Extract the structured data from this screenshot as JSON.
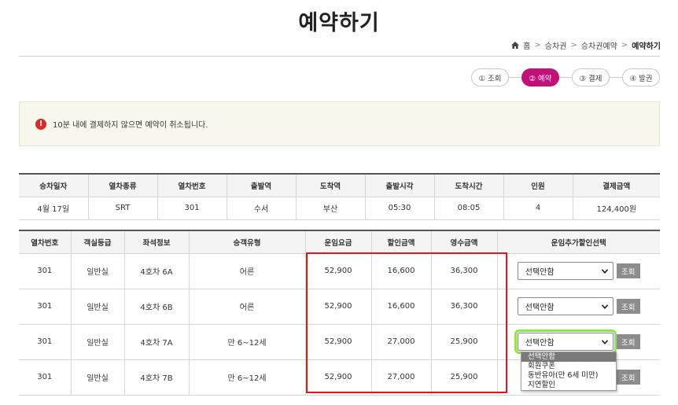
{
  "page": {
    "title": "예약하기"
  },
  "breadcrumb": {
    "home": "홈",
    "items": [
      "승차권",
      "승차권예약"
    ],
    "current": "예약하기"
  },
  "steps": [
    {
      "label": "① 조회",
      "active": false
    },
    {
      "label": "② 예약",
      "active": true
    },
    {
      "label": "③ 결제",
      "active": false
    },
    {
      "label": "④ 발권",
      "active": false
    }
  ],
  "notice": {
    "text": "10분 내에 결제하지 않으면 예약이 취소됩니다."
  },
  "summary": {
    "headers": [
      "승차일자",
      "열차종류",
      "열차번호",
      "출발역",
      "도착역",
      "출발시각",
      "도착시간",
      "인원",
      "결제금액"
    ],
    "row": [
      "4월 17일",
      "SRT",
      "301",
      "수서",
      "부산",
      "05:30",
      "08:05",
      "4",
      "124,400원"
    ]
  },
  "passengers": {
    "headers": [
      "열차번호",
      "객실등급",
      "좌석정보",
      "승객유형",
      "운임요금",
      "할인금액",
      "영수금액",
      "운임추가할인선택"
    ],
    "rows": [
      {
        "train": "301",
        "class": "일반실",
        "seat": "4호차 6A",
        "type": "어른",
        "fare": "52,900",
        "discount": "16,600",
        "receipt": "36,300",
        "select": "선택안함",
        "button": "조회"
      },
      {
        "train": "301",
        "class": "일반실",
        "seat": "4호차 6B",
        "type": "어른",
        "fare": "52,900",
        "discount": "16,600",
        "receipt": "36,300",
        "select": "선택안함",
        "button": "조회"
      },
      {
        "train": "301",
        "class": "일반실",
        "seat": "4호차 7A",
        "type": "만 6~12세",
        "fare": "52,900",
        "discount": "27,000",
        "receipt": "25,900",
        "select": "선택안함",
        "button": "조회"
      },
      {
        "train": "301",
        "class": "일반실",
        "seat": "4호차 7B",
        "type": "만 6~12세",
        "fare": "52,900",
        "discount": "27,000",
        "receipt": "25,900",
        "select": "",
        "button": "조회"
      }
    ]
  },
  "dropdown": {
    "options": [
      "선택안함",
      "회원쿠폰",
      "동반유아(만 6세 미만)",
      "지연할인"
    ],
    "selected_index": 0
  },
  "colors": {
    "accent": "#c0107a",
    "highlight_red": "#e0141a",
    "focus_green": "#8ee64a",
    "alert": "#d82b2b"
  }
}
